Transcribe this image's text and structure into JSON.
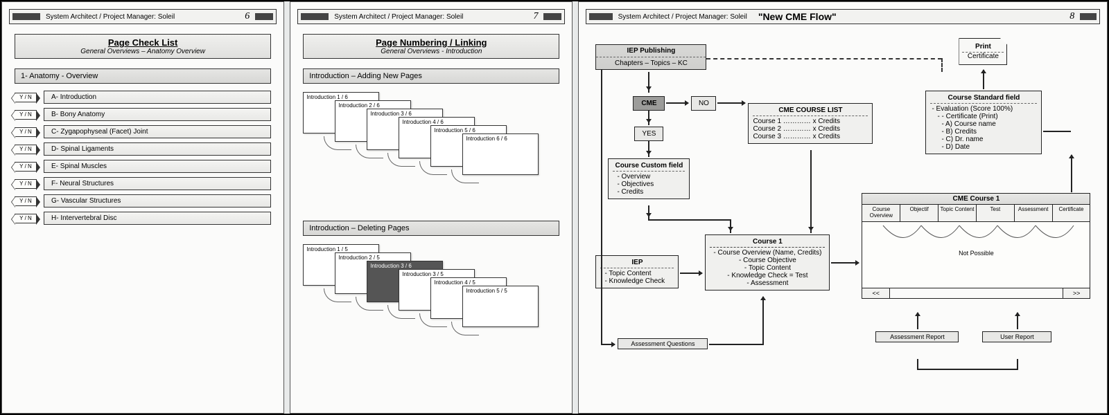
{
  "headerAuthor": "System Architect / Project Manager: Soleil",
  "pages": {
    "p1": "6",
    "p2": "7",
    "p3": "8"
  },
  "panel1": {
    "title": "Page Check List",
    "subtitle": "General Overviews – Anatomy Overview",
    "sectionHeader": "1- Anatomy - Overview",
    "yn": "Y / N",
    "items": [
      "A- Introduction",
      "B- Bony Anatomy",
      "C- Zygapophyseal (Facet) Joint",
      "D- Spinal Ligaments",
      "E- Spinal Muscles",
      "F- Neural Structures",
      "G- Vascular Structures",
      "H- Intervertebral Disc"
    ]
  },
  "panel2": {
    "title": "Page Numbering / Linking",
    "subtitle": "General Overviews - Introduction",
    "addHeader": "Introduction – Adding New Pages",
    "addPages": [
      "Introduction 1 / 6",
      "Introduction 2 / 6",
      "Introduction 3 / 6",
      "Introduction 4 / 6",
      "Introduction 5 / 6",
      "Introduction 6 / 6"
    ],
    "delHeader": "Introduction – Deleting Pages",
    "delPages": [
      "Introduction 1 / 5",
      "Introduction 2 / 5",
      "Introduction 3 / 6",
      "Introduction 3 / 5",
      "Introduction 4 / 5",
      "Introduction 5 / 5"
    ]
  },
  "panel3": {
    "flowTitle": "\"New CME Flow\"",
    "iepPub": {
      "l1": "IEP Publishing",
      "l2": "Chapters – Topics – KC"
    },
    "cme": "CME",
    "no": "NO",
    "yes": "YES",
    "customField": {
      "title": "Course Custom field",
      "items": [
        "Overview",
        "Objectives",
        "Credits"
      ]
    },
    "courseList": {
      "title": "CME COURSE LIST",
      "rows": [
        "Course 1 ………… x Credits",
        "Course 2 ………… x Credits",
        "Course 3 ………… x Credits"
      ]
    },
    "print": "Print",
    "certificate": "Certificate",
    "standardField": {
      "title": "Course Standard field",
      "items": [
        "Evaluation (Score 100%)",
        "- Certificate (Print)",
        "A) Course name",
        "B) Credits",
        "C) Dr. name",
        "D) Date"
      ]
    },
    "iep": {
      "title": "IEP",
      "items": [
        "Topic Content",
        "Knowledge Check"
      ]
    },
    "course1": {
      "title": "Course 1",
      "items": [
        "Course Overview (Name, Credits)",
        "Course Objective",
        "Topic Content",
        "Knowledge Check = Test",
        "Assessment"
      ]
    },
    "cmeCourse1": {
      "title": "CME Course 1",
      "tabs": [
        "Course Overview",
        "Objectif",
        "Topic Content",
        "Test",
        "Assessment",
        "Certificate"
      ],
      "notPossible": "Not Possible",
      "prev": "<<",
      "next": ">>"
    },
    "assessmentQuestions": "Assessment Questions",
    "assessmentReport": "Assessment Report",
    "userReport": "User Report"
  }
}
